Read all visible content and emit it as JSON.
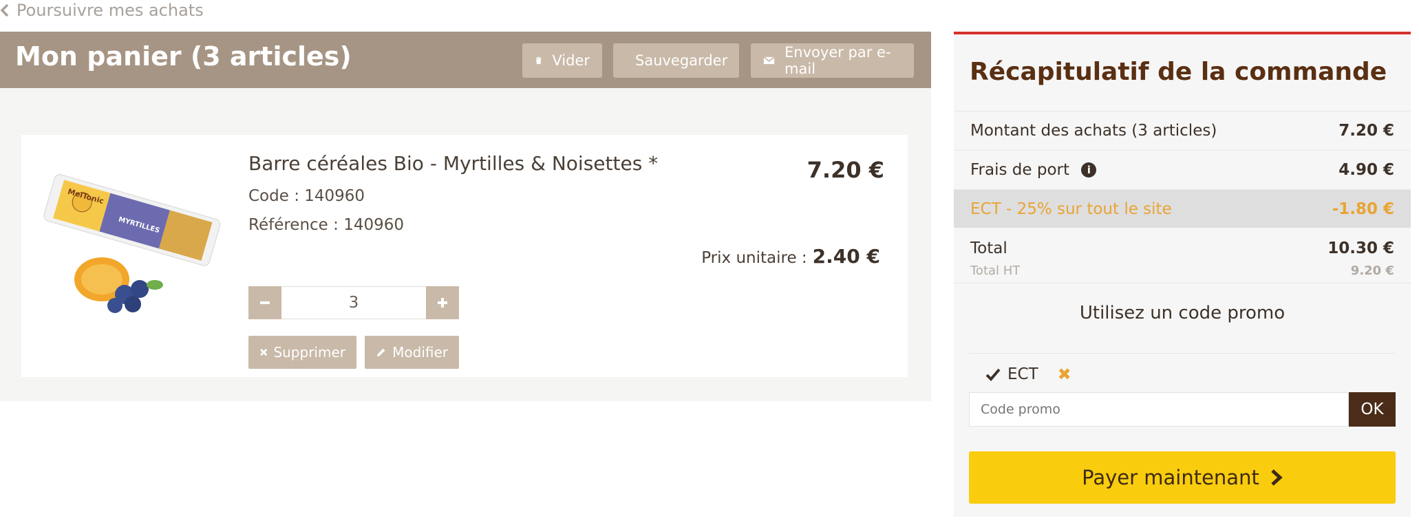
{
  "nav": {
    "back_label": "Poursuivre mes achats"
  },
  "cart": {
    "title": "Mon panier (3 articles)",
    "actions": {
      "empty_label": "Vider",
      "save_label": "Sauvegarder",
      "email_label": "Envoyer par e-mail"
    },
    "item": {
      "name": "Barre céréales Bio - Myrtilles & Noisettes *",
      "code": "Code : 140960",
      "reference": "Référence  : 140960",
      "price": "7.20 €",
      "unit_price_label": "Prix unitaire :",
      "unit_price": "2.40 €",
      "quantity": "3",
      "delete_label": "Supprimer",
      "edit_label": "Modifier",
      "image_brand": "MelTonic",
      "image_flavor": "MYRTILLES"
    }
  },
  "summary": {
    "title": "Récapitulatif de la commande",
    "rows": {
      "purchases_label": "Montant des achats  (3 articles)",
      "purchases_amount": "7.20 €",
      "shipping_label": "Frais de port",
      "shipping_amount": "4.90 €",
      "discount_label": "ECT - 25% sur tout le site",
      "discount_amount": "-1.80 €",
      "total_label": "Total",
      "total_amount": "10.30 €",
      "total_ht_label": "Total HT",
      "total_ht_amount": "9.20 €"
    },
    "promo": {
      "title": "Utilisez un code promo",
      "applied_code": "ECT",
      "placeholder": "Code promo",
      "ok_label": "OK"
    },
    "pay_label": "Payer maintenant"
  },
  "colors": {
    "header_bg": "#a69584",
    "button_bg": "#c9b9a8",
    "accent_red": "#d7312b",
    "discount": "#e9a434",
    "pay_button": "#f9cc0d",
    "title_brown": "#5a2f12"
  }
}
